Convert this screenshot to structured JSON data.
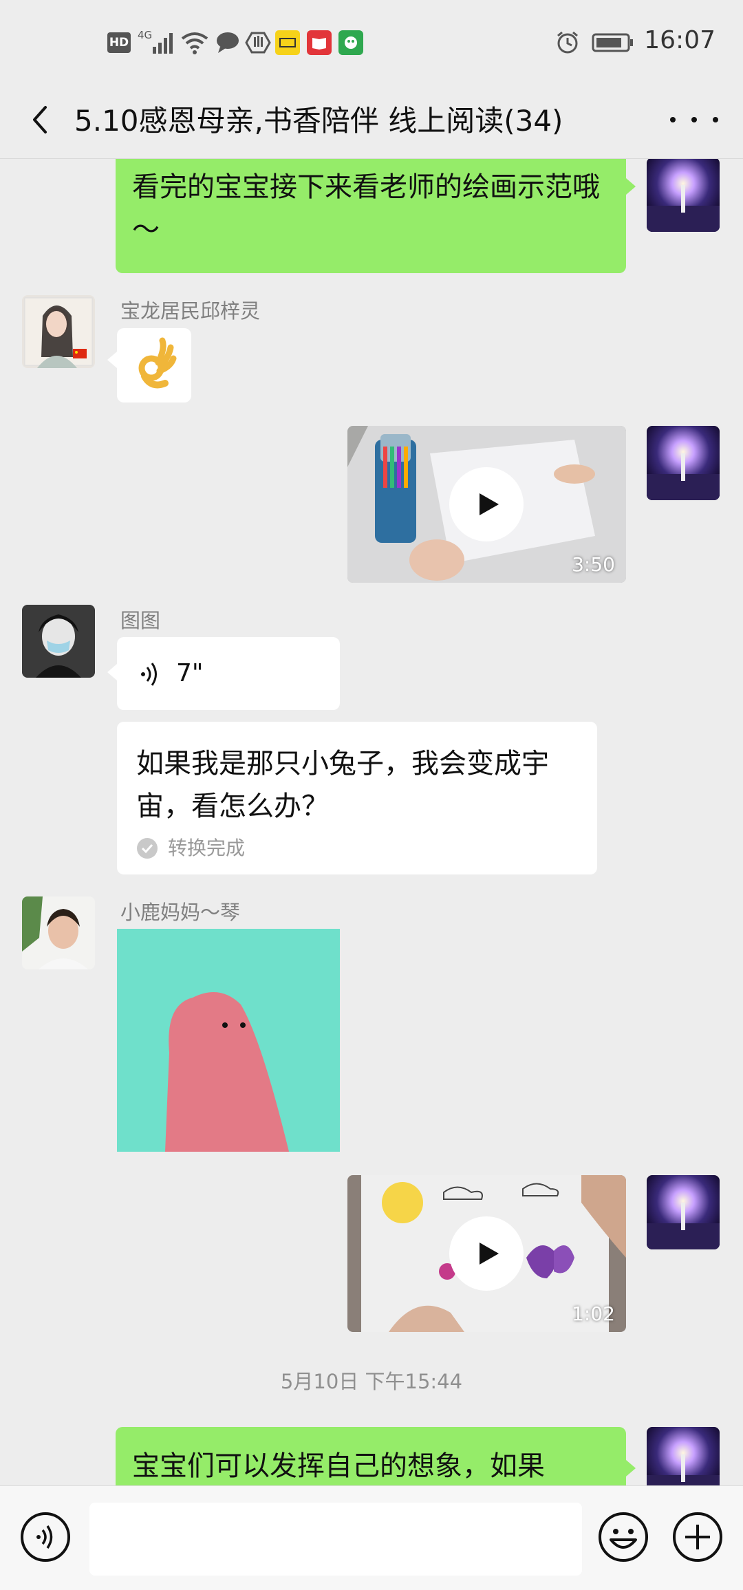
{
  "status_bar": {
    "hd": "HD",
    "network": "4G",
    "time": "16:07"
  },
  "nav": {
    "title": "5.10感恩母亲,书香陪伴 线上阅读(34)"
  },
  "messages": {
    "m1": {
      "text": "看完的宝宝接下来看老师的绘画示范哦～"
    },
    "m2": {
      "sender": "宝龙居民邱梓灵",
      "emoji": "ok-hand"
    },
    "m3": {
      "duration": "3:50"
    },
    "m4": {
      "sender": "图图",
      "voice_length": "7\""
    },
    "m5": {
      "text": "如果我是那只小兔子，我会变成宇宙，看怎么办？",
      "status": "转换完成"
    },
    "m6": {
      "sender": "小鹿妈妈～琴"
    },
    "m7": {
      "duration": "1:02"
    },
    "m8": {
      "timestamp": "5月10日 下午15:44"
    },
    "m9": {
      "text": "宝宝们可以发挥自己的想象，如果"
    }
  },
  "colors": {
    "bubble_self": "#95ec69",
    "bubble_other": "#ffffff",
    "background": "#ededed"
  }
}
